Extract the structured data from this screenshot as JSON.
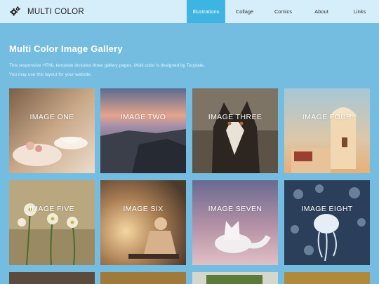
{
  "header": {
    "brand": "MULTI COLOR",
    "brand_icon": "gears-icon",
    "nav": [
      "Illustrations",
      "Collage",
      "Comics",
      "About",
      "Links"
    ],
    "active_nav": "Illustrations"
  },
  "main": {
    "title": "Multi Color Image Gallery",
    "intro": "This responsive HTML template includes three gallery pages. Multi color is designed by Tooplate. You may use this layout for your website."
  },
  "gallery": [
    {
      "caption": "IMAGE ONE"
    },
    {
      "caption": "IMAGE TWO"
    },
    {
      "caption": "IMAGE THREE"
    },
    {
      "caption": "IMAGE FOUR"
    },
    {
      "caption": "IMAGE FIVE"
    },
    {
      "caption": "IMAGE SIX"
    },
    {
      "caption": "IMAGE SEVEN"
    },
    {
      "caption": "IMAGE EIGHT"
    }
  ],
  "colors": {
    "page_bg": "#74bde0",
    "header_bg": "#d6eef9",
    "active_nav_bg": "#3eb4e3"
  }
}
